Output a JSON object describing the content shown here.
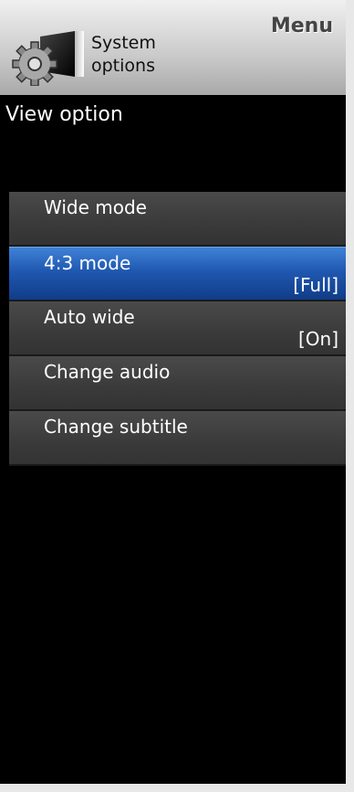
{
  "header": {
    "menu_label": "Menu",
    "section_line1": "System",
    "section_line2": "options",
    "section_icon": "gear-monitor-icon"
  },
  "subheader": {
    "title": "View option"
  },
  "options": [
    {
      "label": "Wide mode",
      "value": ""
    },
    {
      "label": "4:3 mode",
      "value": "[Full]",
      "selected": true
    },
    {
      "label": "Auto wide",
      "value": "[On]"
    },
    {
      "label": "Change audio",
      "value": ""
    },
    {
      "label": "Change subtitle",
      "value": ""
    }
  ],
  "colors": {
    "selected": "#2058b0",
    "item_bg": "#3f3f3f",
    "screen_bg": "#000000"
  }
}
